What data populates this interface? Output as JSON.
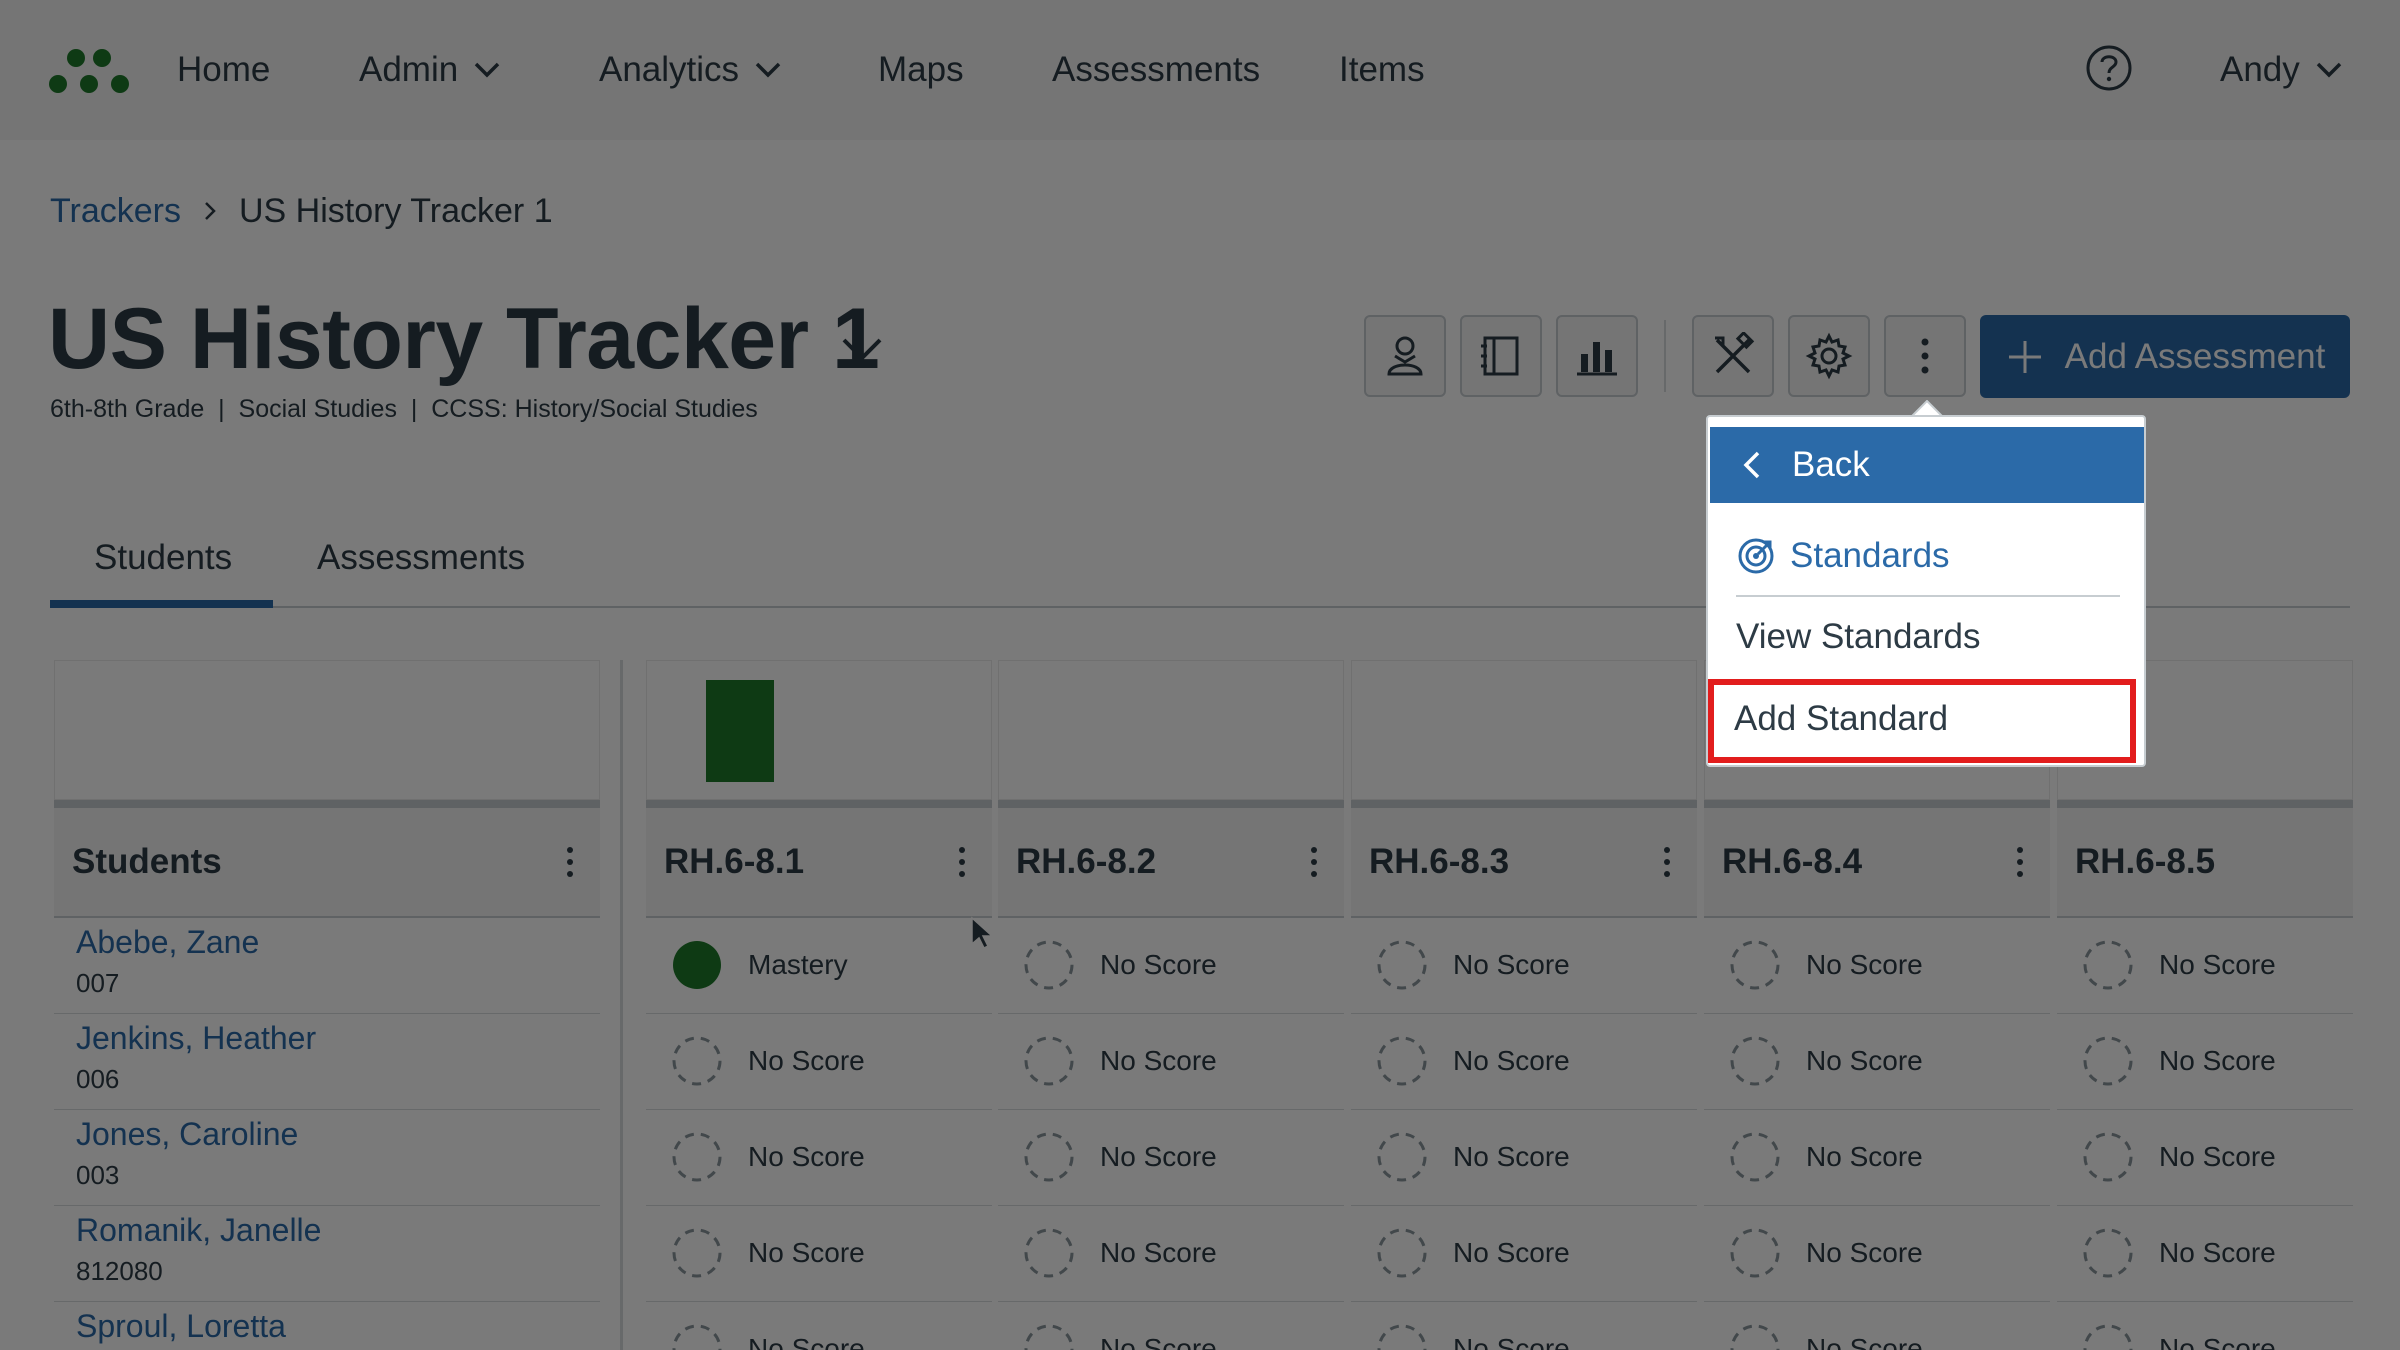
{
  "nav": {
    "items": [
      {
        "label": "Home",
        "has_chevron": false
      },
      {
        "label": "Admin",
        "has_chevron": true
      },
      {
        "label": "Analytics",
        "has_chevron": true
      },
      {
        "label": "Maps",
        "has_chevron": false
      },
      {
        "label": "Assessments",
        "has_chevron": false
      },
      {
        "label": "Items",
        "has_chevron": false
      }
    ],
    "user": "Andy",
    "help_icon": "question-circle-icon",
    "logo_icon": "dots-logo-icon"
  },
  "breadcrumb": {
    "parent": "Trackers",
    "current": "US History Tracker 1"
  },
  "page": {
    "title": "US History Tracker 1",
    "subtitle": "6th-8th Grade  |  Social Studies  |  CCSS: History/Social Studies"
  },
  "toolbar": {
    "icons": [
      "student-icon",
      "notebook-icon",
      "bar-chart-icon",
      "tools-icon",
      "gear-icon",
      "more-vertical-icon"
    ],
    "add_assessment_label": "Add Assessment"
  },
  "tabs": [
    {
      "label": "Students",
      "active": true
    },
    {
      "label": "Assessments",
      "active": false
    }
  ],
  "grid": {
    "students_header": "Students",
    "standards": [
      "RH.6-8.1",
      "RH.6-8.2",
      "RH.6-8.3",
      "RH.6-8.4",
      "RH.6-8.5"
    ],
    "students": [
      {
        "name": "Abebe, Zane",
        "id": "007",
        "scores": [
          "Mastery",
          "No Score",
          "No Score",
          "No Score",
          "No Score"
        ]
      },
      {
        "name": "Jenkins, Heather",
        "id": "006",
        "scores": [
          "No Score",
          "No Score",
          "No Score",
          "No Score",
          "No Score"
        ]
      },
      {
        "name": "Jones, Caroline",
        "id": "003",
        "scores": [
          "No Score",
          "No Score",
          "No Score",
          "No Score",
          "No Score"
        ]
      },
      {
        "name": "Romanik, Janelle",
        "id": "812080",
        "scores": [
          "No Score",
          "No Score",
          "No Score",
          "No Score",
          "No Score"
        ]
      },
      {
        "name": "Sproul, Loretta",
        "id": "",
        "scores": [
          "No Score",
          "No Score",
          "No Score",
          "No Score",
          "No Score"
        ]
      }
    ]
  },
  "menu": {
    "back_label": "Back",
    "group_label": "Standards",
    "items": [
      "View Standards",
      "Add Standard"
    ],
    "highlighted": "Add Standard"
  },
  "colors": {
    "accent": "#2b6aa8",
    "mastery": "#1e7a2a",
    "highlight": "#e21d1d"
  }
}
